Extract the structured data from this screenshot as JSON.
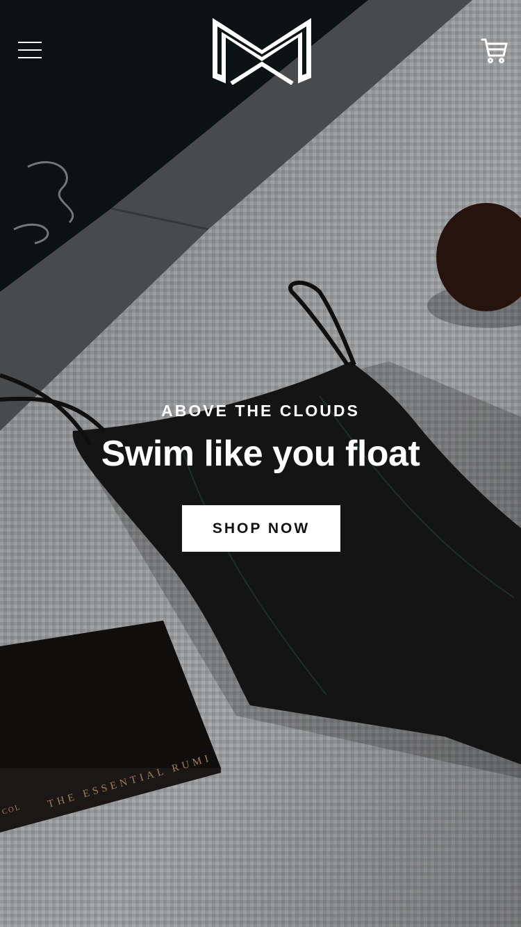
{
  "header": {
    "menu_icon": "hamburger-menu-icon",
    "logo_icon": "brand-logo-icon",
    "cart_icon": "shopping-cart-icon"
  },
  "hero": {
    "eyebrow": "ABOVE THE CLOUDS",
    "headline": "Swim like you float",
    "cta_label": "SHOP NOW",
    "book_title": "THE ESSENTIAL RUMI",
    "book_spine_partial": "COL"
  },
  "colors": {
    "text": "#ffffff",
    "button_bg": "#ffffff",
    "button_text": "#111111",
    "towel": "#a9abad",
    "swimsuit": "#161616",
    "book": "#120f0f",
    "pool": "#0c1516",
    "stone": "#545658"
  }
}
